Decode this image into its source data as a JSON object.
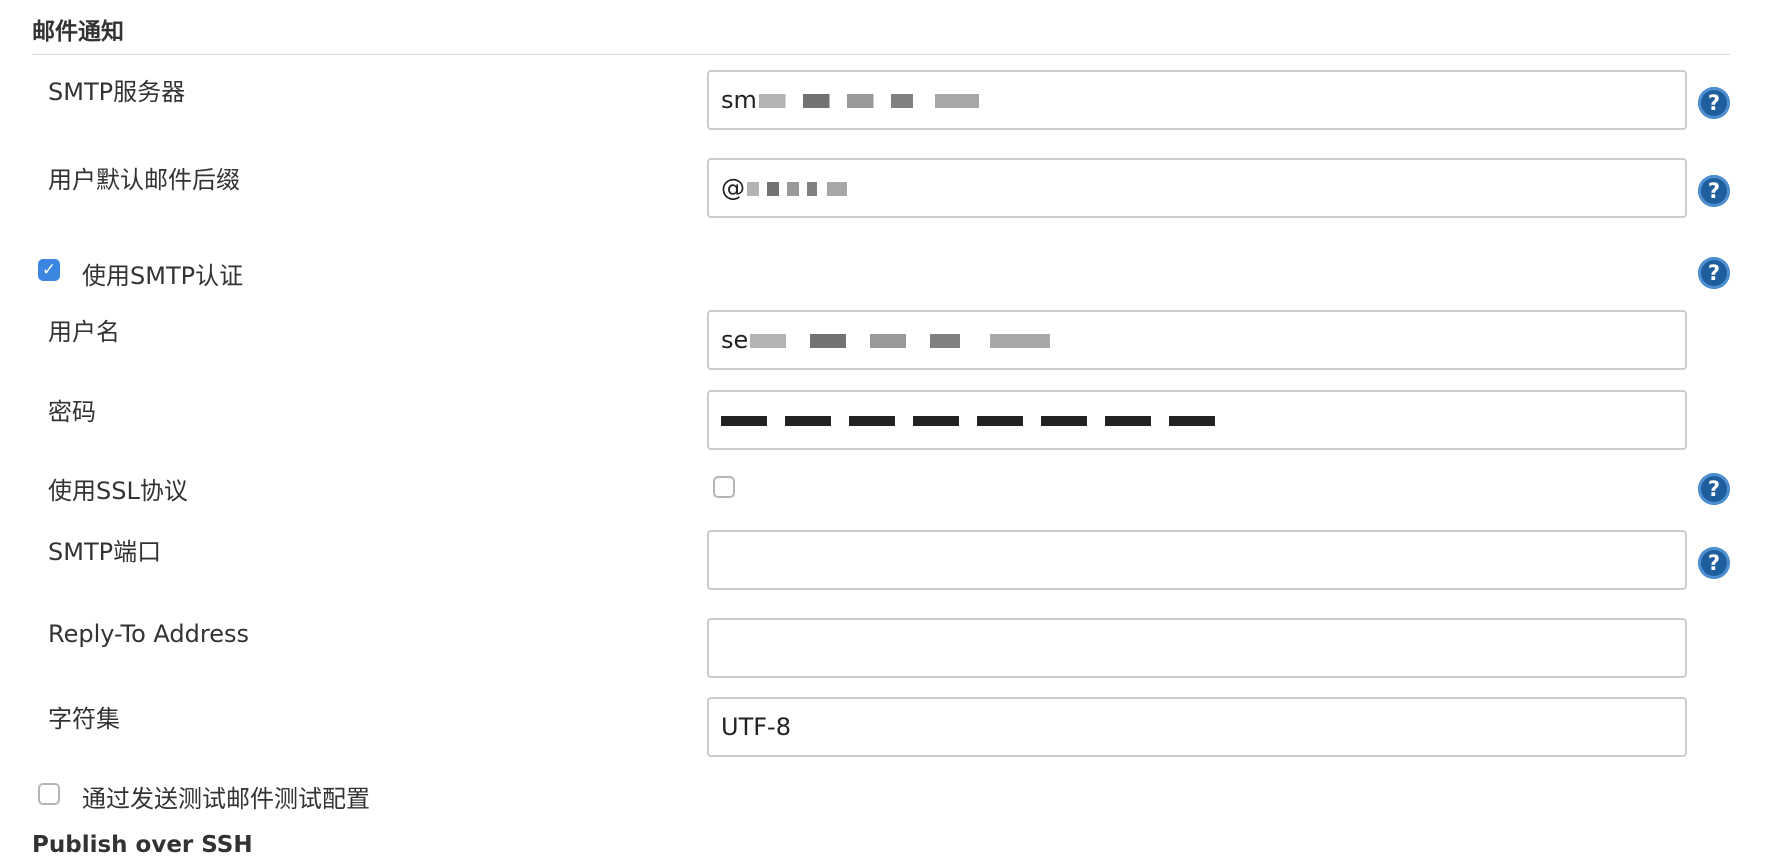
{
  "section": {
    "title": "邮件通知"
  },
  "fields": {
    "smtp_server": {
      "label": "SMTP服务器",
      "value_prefix": "sm"
    },
    "default_suffix": {
      "label": "用户默认邮件后缀",
      "value_prefix": "@"
    },
    "use_smtp_auth": {
      "label": "使用SMTP认证",
      "checked": true
    },
    "username": {
      "label": "用户名",
      "value_prefix": "se"
    },
    "password": {
      "label": "密码",
      "value_mask": "••••••••••••••••••••••••••••••••"
    },
    "use_ssl": {
      "label": "使用SSL协议",
      "checked": false
    },
    "smtp_port": {
      "label": "SMTP端口",
      "value": ""
    },
    "reply_to": {
      "label": "Reply-To Address",
      "value": ""
    },
    "charset": {
      "label": "字符集",
      "value": "UTF-8"
    },
    "test_config": {
      "label": "通过发送测试邮件测试配置",
      "checked": false
    }
  },
  "help_icon": {
    "glyph": "?",
    "color": "#1f5e9c"
  },
  "next_section": {
    "title": "Publish over SSH"
  }
}
